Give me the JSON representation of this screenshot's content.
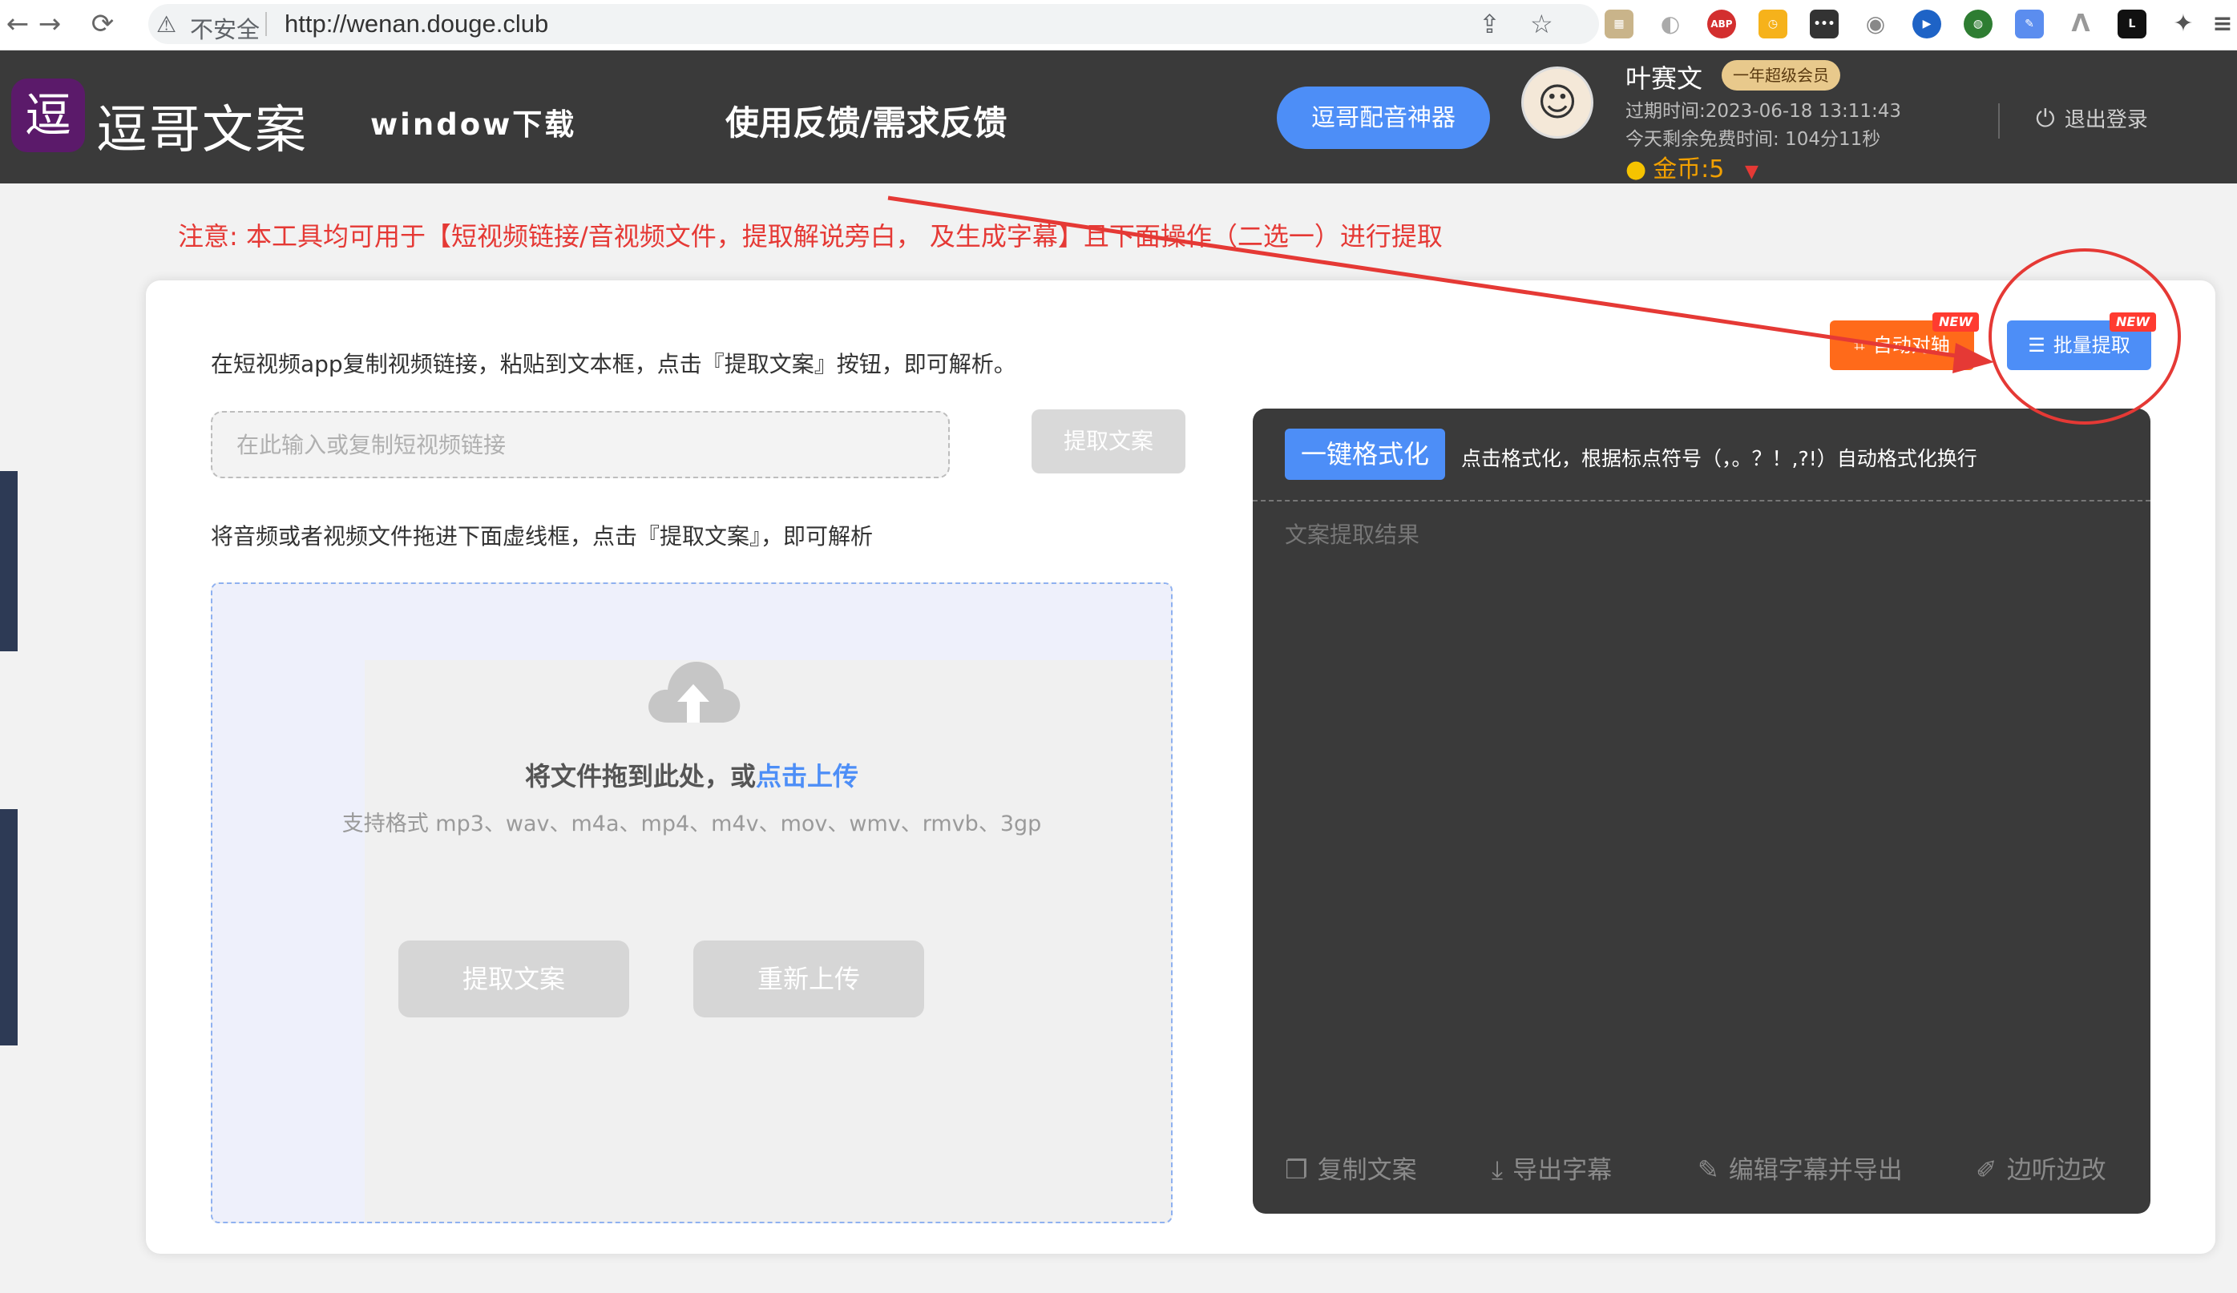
{
  "browser": {
    "back_icon": "←",
    "forward_icon": "→",
    "reload_icon": "⟳",
    "security_label": "不安全",
    "url": "http://wenan.douge.club"
  },
  "header": {
    "logo_glyph": "逗",
    "logo_text": "逗哥文案",
    "nav_download": "window下载",
    "nav_feedback": "使用反馈/需求反馈",
    "dub_button": "逗哥配音神器",
    "user": {
      "name": "叶赛文",
      "vip_badge": "一年超级会员",
      "expiry": "过期时间:2023-06-18 13:11:43",
      "free_time": "今天剩余免费时间:  104分11秒",
      "coins": "金币:5"
    },
    "logout": "退出登录"
  },
  "notice": "注意:  本工具均可用于【短视频链接/音视频文件，提取解说旁白，  及生成字幕】且下面操作（二选一）进行提取",
  "tabs": {
    "auto_axis": "自动对轴",
    "batch_extract": "批量提取",
    "new_tag": "NEW"
  },
  "link_section": {
    "instruction": "在短视频app复制视频链接，粘贴到文本框，点击『提取文案』按钮，即可解析。",
    "placeholder": "在此输入或复制短视频链接",
    "extract_button": "提取文案"
  },
  "file_section": {
    "instruction": "将音频或者视频文件拖进下面虚线框，点击『提取文案』，即可解析",
    "drop_title": "将文件拖到此处，或",
    "upload_link": "点击上传",
    "formats": "支持格式 mp3、wav、m4a、mp4、m4v、mov、wmv、rmvb、3gp",
    "extract_button": "提取文案",
    "reupload_button": "重新上传"
  },
  "result_panel": {
    "format_button": "一键格式化",
    "format_hint": "点击格式化，根据标点符号（，。？！,?!）自动格式化换行",
    "placeholder": "文案提取结果",
    "actions": [
      "复制文案",
      "导出字幕",
      "编辑字幕并导出",
      "边听边改"
    ]
  },
  "colors": {
    "accent": "#4d8ef7",
    "header_bg": "#3a3a3a",
    "notice": "#e53935",
    "annotation": "#e53935"
  }
}
